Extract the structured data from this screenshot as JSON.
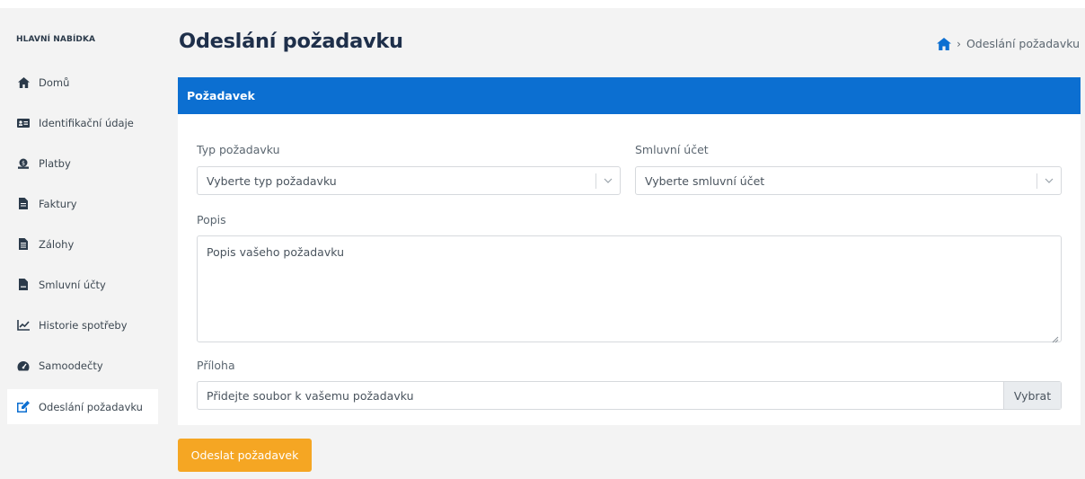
{
  "sidebar": {
    "heading": "HLAVNÍ NABÍDKA",
    "items": [
      {
        "label": "Domů",
        "icon": "home-icon"
      },
      {
        "label": "Identifikační údaje",
        "icon": "id-card-icon"
      },
      {
        "label": "Platby",
        "icon": "money-icon"
      },
      {
        "label": "Faktury",
        "icon": "invoice-icon"
      },
      {
        "label": "Zálohy",
        "icon": "document-icon"
      },
      {
        "label": "Smluvní účty",
        "icon": "contract-icon"
      },
      {
        "label": "Historie spotřeby",
        "icon": "chart-line-icon"
      },
      {
        "label": "Samoodečty",
        "icon": "gauge-icon"
      },
      {
        "label": "Odeslání požadavku",
        "icon": "edit-icon",
        "active": true
      }
    ]
  },
  "header": {
    "title": "Odeslání požadavku",
    "breadcrumb": {
      "current": "Odeslání požadavku"
    }
  },
  "card": {
    "title": "Požadavek",
    "type_label": "Typ požadavku",
    "type_placeholder": "Vyberte typ požadavku",
    "account_label": "Smluvní účet",
    "account_placeholder": "Vyberte smluvní účet",
    "desc_label": "Popis",
    "desc_placeholder": "Popis vašeho požadavku",
    "attach_label": "Příloha",
    "attach_placeholder": "Přidejte soubor k vašemu požadavku",
    "attach_button": "Vybrat"
  },
  "submit_label": "Odeslat požadavek",
  "colors": {
    "accent": "#0c6fd1",
    "submit": "#f5a623",
    "title": "#1e2f4a"
  }
}
